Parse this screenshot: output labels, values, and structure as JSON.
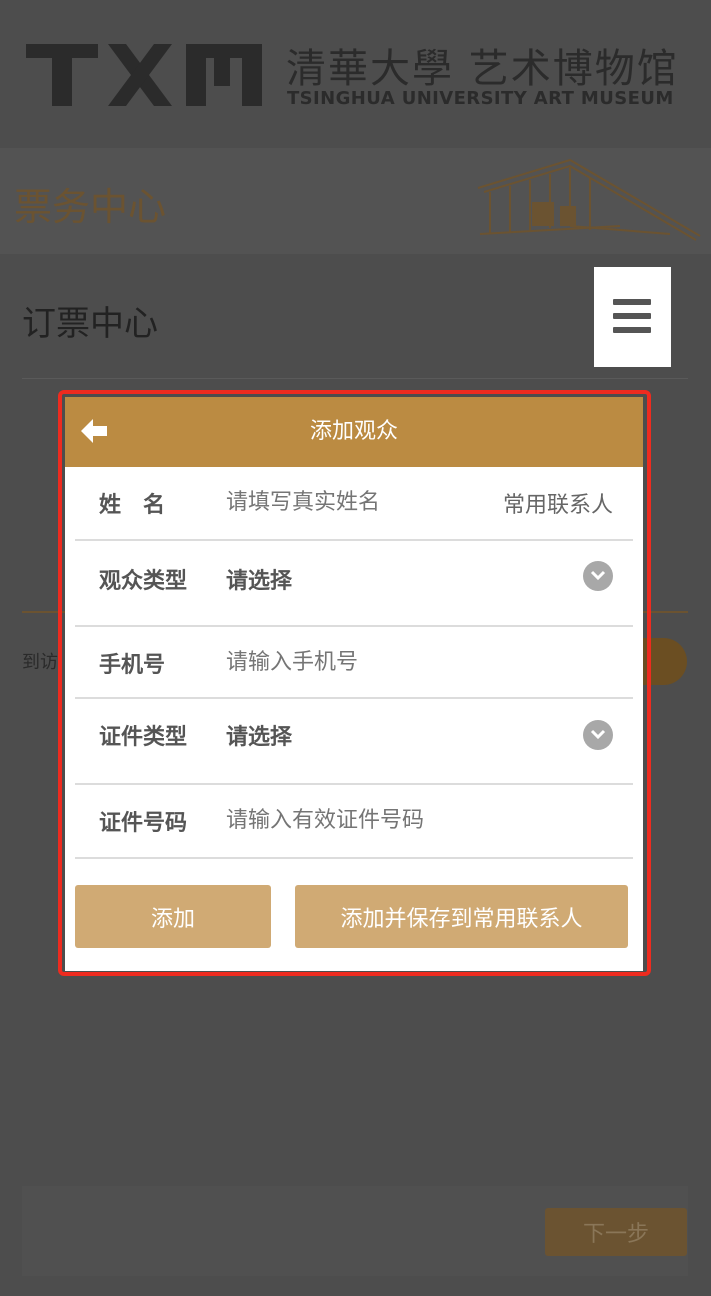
{
  "header": {
    "logo_cn": "清華大學 艺术博物馆",
    "logo_en": "TSINGHUA UNIVERSITY ART MUSEUM"
  },
  "banner": {
    "title": "票务中心"
  },
  "booking": {
    "title": "订票中心"
  },
  "background": {
    "visit_prefix": "到访",
    "next_label": "下一步"
  },
  "modal": {
    "title": "添加观众",
    "rows": [
      {
        "label": "姓　名",
        "placeholder": "请填写真实姓名",
        "link": "常用联系人"
      },
      {
        "label": "观众类型",
        "value": "请选择"
      },
      {
        "label": "手机号",
        "placeholder": "请输入手机号"
      },
      {
        "label": "证件类型",
        "value": "请选择"
      },
      {
        "label": "证件号码",
        "placeholder": "请输入有效证件号码"
      }
    ],
    "add_label": "添加",
    "add_save_label": "添加并保存到常用联系人"
  },
  "colors": {
    "accent": "#bb8b42",
    "button": "#d0aa74",
    "overlay": "#4d4d4d",
    "highlight_border": "#ee2b1f"
  },
  "icons": [
    "menu-icon",
    "back-arrow-icon",
    "chevron-down-icon"
  ]
}
